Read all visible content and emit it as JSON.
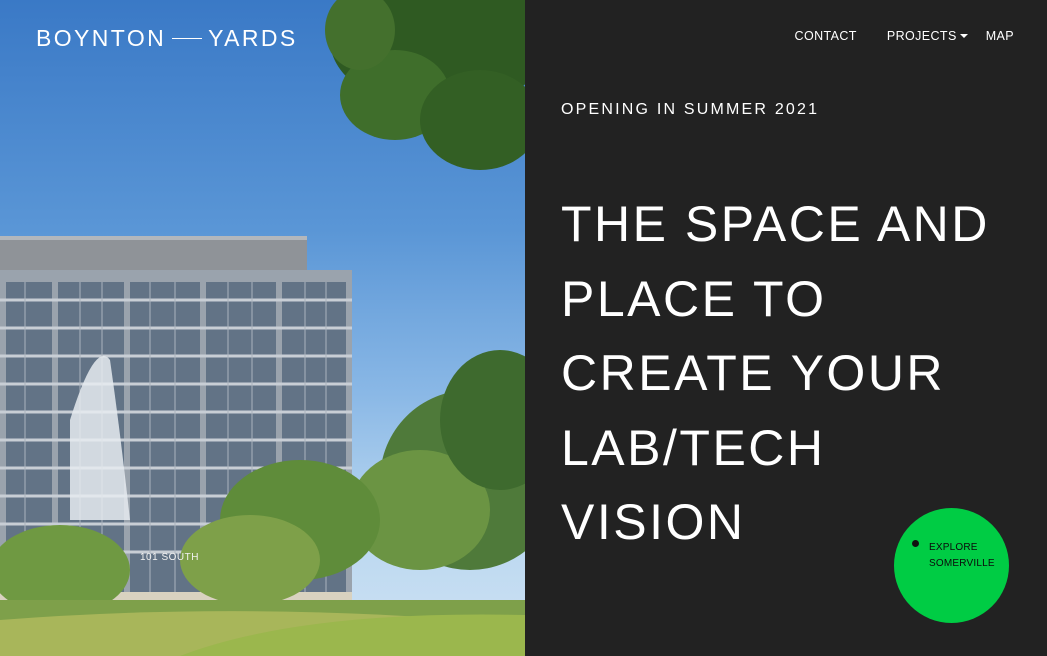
{
  "logo": {
    "left": "BOYNTON",
    "right": "YARDS"
  },
  "nav": {
    "contact": "CONTACT",
    "projects": "PROJECTS",
    "map": "MAP"
  },
  "hero": {
    "eyebrow": "OPENING IN SUMMER 2021",
    "headline_lines": [
      "THE SPACE AND",
      "PLACE TO",
      "CREATE YOUR",
      "LAB/TECH",
      "VISION"
    ],
    "building_sign": "101 SOUTH"
  },
  "explore_button": {
    "line1": "EXPLORE",
    "line2": "SOMERVILLE",
    "color": "#00cc44"
  },
  "colors": {
    "background": "#222222",
    "text": "#ffffff",
    "accent": "#00cc44"
  },
  "icons": {
    "dropdown": "caret-down-icon",
    "explore_dot": "dot-icon"
  }
}
